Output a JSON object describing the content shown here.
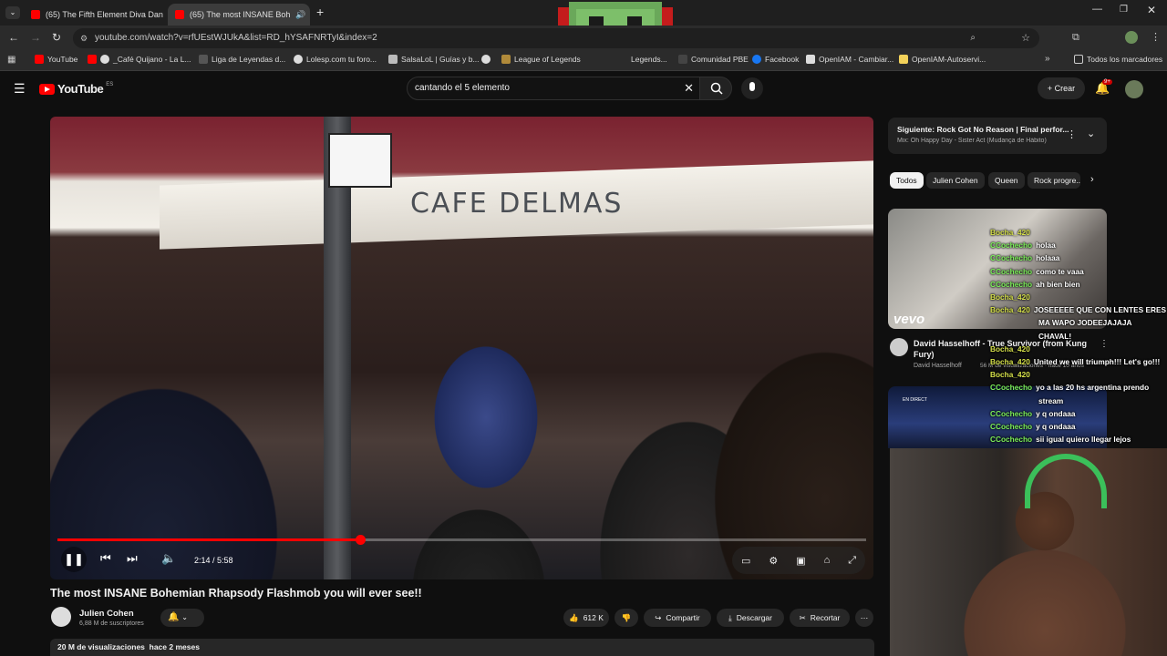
{
  "browser": {
    "tabs": [
      {
        "title": "(65) The Fifth Element Diva Dan",
        "active": false
      },
      {
        "title": "(65) The most INSANE Boh",
        "active": true
      }
    ],
    "url": "youtube.com/watch?v=rfUEstWJUkA&list=RD_hYSAFNRTyI&index=2",
    "bookmarks": [
      "YouTube",
      "_Café Quijano - La L...",
      "Liga de Leyendas d...",
      "Lolesp.com tu foro...",
      "SalsaLoL | Guías y b...",
      "",
      "League of Legends",
      "Legends...",
      "Comunidad PBE",
      "Facebook",
      "OpenIAM - Cambiar...",
      "OpenIAM-Autoservi..."
    ],
    "all_bookmarks": "Todos los marcadores"
  },
  "youtube": {
    "logo": "YouTube",
    "logo_region": "ES",
    "search_value": "cantando el 5 elemento",
    "create_label": "Crear",
    "notif_count": "9+"
  },
  "player": {
    "current_time": "2:14",
    "duration": "5:58",
    "time_display": "2:14 / 5:58",
    "progress": 0.374,
    "sign_text": "CAFE DELMAS"
  },
  "video": {
    "title": "The most INSANE Bohemian Rhapsody Flashmob you will ever see!!",
    "channel": "Julien Cohen",
    "subscribers": "6,88 M de suscriptores",
    "likes": "612 K",
    "share_label": "Compartir",
    "download_label": "Descargar",
    "clip_label": "Recortar",
    "views": "20 M de visualizaciones",
    "date": "hace 2 meses"
  },
  "sidebar": {
    "next_title": "Siguiente: Rock Got No Reason | Final perfor...",
    "next_sub": "Mix: Oh Happy Day - Sister Act (Mudança de Hábito)",
    "chips": [
      "Todos",
      "Julien Cohen",
      "Queen",
      "Rock progre..."
    ],
    "rec1": {
      "title": "David Hasselhoff - True Survivor (from Kung Fury)",
      "channel": "David Hasselhoff",
      "meta": "56 M de visualizaciones · hace 10 años",
      "badge": "vevo"
    },
    "rec2_badge": "EN DIRECT"
  },
  "chat": [
    {
      "user": "Bocha_420",
      "msg": "",
      "color": "#d5e04a"
    },
    {
      "user": "CCochecho",
      "msg": "holaa",
      "color": "#7df05b"
    },
    {
      "user": "CCochecho",
      "msg": "holaaa",
      "color": "#7df05b"
    },
    {
      "user": "CCochecho",
      "msg": "como te vaaa",
      "color": "#7df05b"
    },
    {
      "user": "CCochecho",
      "msg": "ah bien bien",
      "color": "#7df05b"
    },
    {
      "user": "Bocha_420",
      "msg": "",
      "color": "#d5e04a"
    },
    {
      "user": "Bocha_420",
      "msg": "JOSEEEEE QUE CON LENTES ERES",
      "color": "#d5e04a"
    },
    {
      "user": "",
      "msg": "MA WAPO JODEEJAJAJA",
      "color": ""
    },
    {
      "user": "",
      "msg": "CHAVAL!",
      "color": ""
    },
    {
      "user": "Bocha_420",
      "msg": "",
      "color": "#d5e04a"
    },
    {
      "user": "Bocha_420",
      "msg": "United we will triumph!!! Let's go!!!",
      "color": "#d5e04a"
    },
    {
      "user": "Bocha_420",
      "msg": "",
      "color": "#d5e04a"
    },
    {
      "user": "CCochecho",
      "msg": "yo a las 20 hs argentina prendo",
      "color": "#7df05b"
    },
    {
      "user": "",
      "msg": "stream",
      "color": ""
    },
    {
      "user": "CCochecho",
      "msg": "y q ondaaa",
      "color": "#7df05b"
    },
    {
      "user": "CCochecho",
      "msg": "y q ondaaa",
      "color": "#7df05b"
    },
    {
      "user": "CCochecho",
      "msg": "sii igual quiero llegar lejos",
      "color": "#7df05b"
    }
  ],
  "colors": {
    "accent": "#ff0000",
    "bg": "#0f0f0f",
    "chip": "#272727"
  }
}
